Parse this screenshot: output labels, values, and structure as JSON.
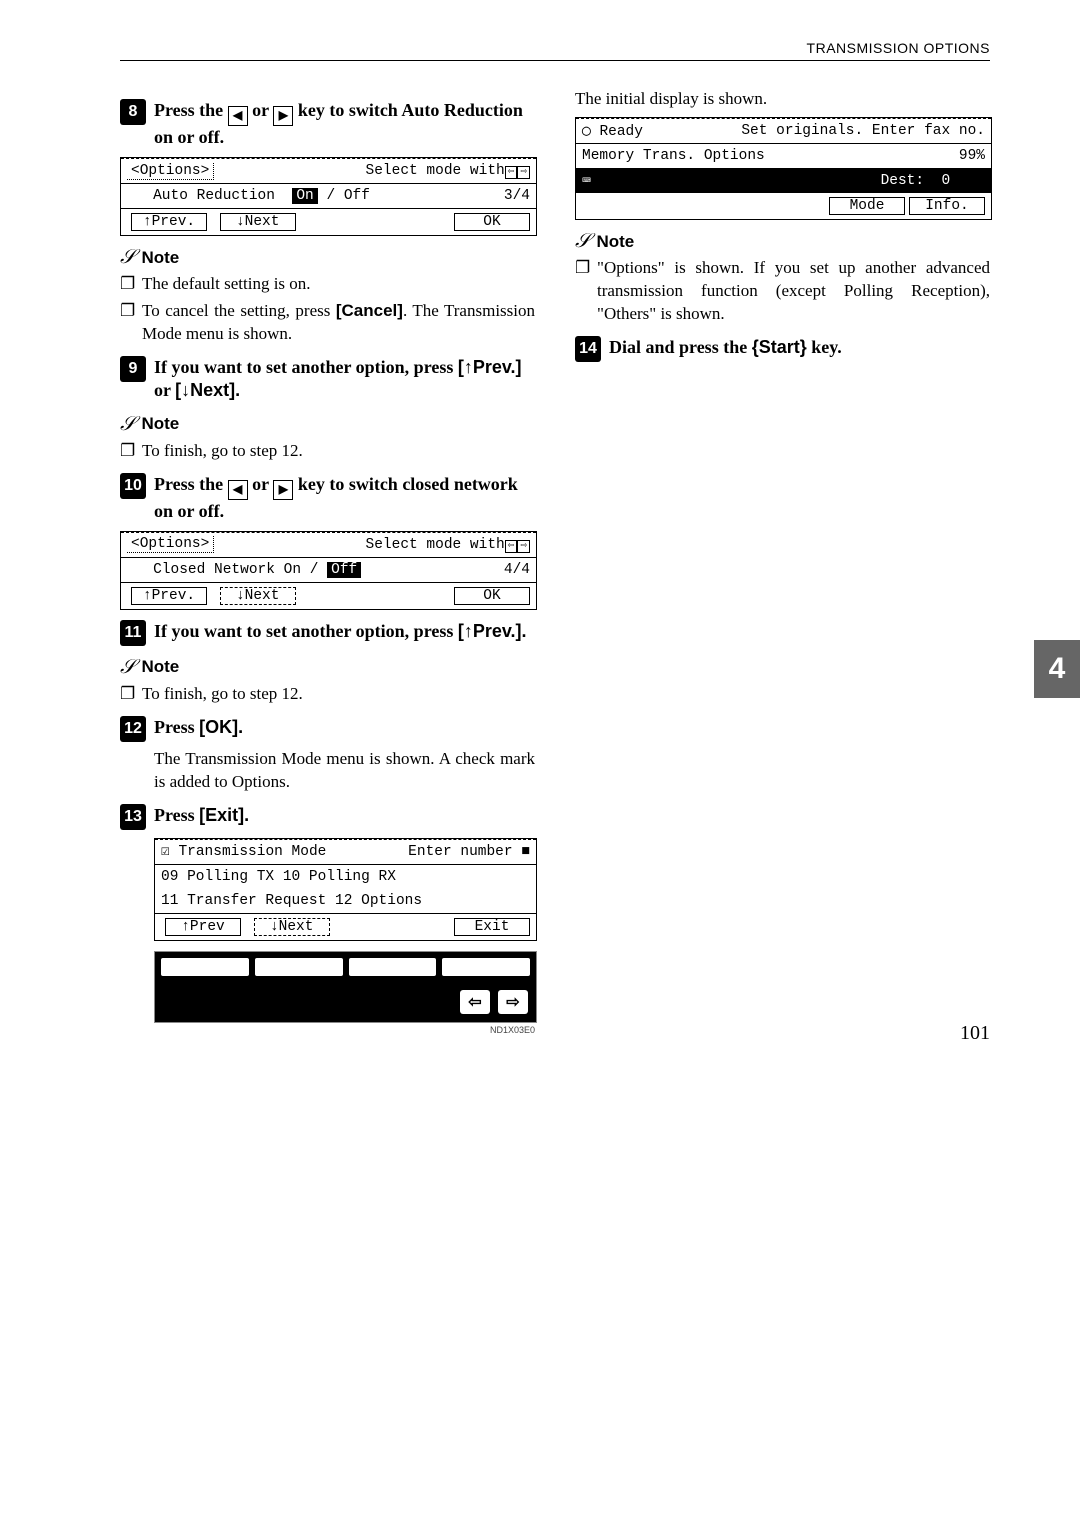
{
  "header": {
    "section_title": "TRANSMISSION OPTIONS"
  },
  "side_tab": "4",
  "page_number": "101",
  "left": {
    "step8": {
      "num": "8",
      "text_a": "Press the ",
      "text_b": " or ",
      "text_c": " key to switch Auto Reduction on or off."
    },
    "lcd1": {
      "title_left": "<Options>",
      "title_right": "Select mode with",
      "line2_left": "Auto Reduction",
      "line2_on": "On",
      "line2_off": " / Off",
      "line2_right": "3/4",
      "btn_prev": "↑Prev.",
      "btn_next": "↓Next",
      "btn_ok": "OK"
    },
    "note1": {
      "label": "Note",
      "items": [
        "The default setting is on.",
        "To cancel the setting, press [Cancel]. The Transmission Mode menu is shown."
      ]
    },
    "step9": {
      "num": "9",
      "text": "If you want to set another option, press [↑Prev.] or [↓Next]."
    },
    "note2": {
      "label": "Note",
      "items": [
        "To finish, go to step 12."
      ]
    },
    "step10": {
      "num": "10",
      "text_a": "Press the ",
      "text_b": " or ",
      "text_c": " key to switch closed network on or off."
    },
    "lcd2": {
      "title_left": "<Options>",
      "title_right": "Select mode with",
      "line2_left": "Closed Network  On / ",
      "line2_off": "Off",
      "line2_right": "4/4",
      "btn_prev": "↑Prev.",
      "btn_next": "↓Next",
      "btn_ok": "OK"
    },
    "step11": {
      "num": "11",
      "text": "If you want to set another option, press [↑Prev.]."
    },
    "note3": {
      "label": "Note",
      "items": [
        "To finish, go to step 12."
      ]
    },
    "step12": {
      "num": "12",
      "text": "Press [OK]."
    },
    "body12": "The Transmission Mode menu is shown. A check mark is added to Options.",
    "step13": {
      "num": "13",
      "text": "Press [Exit]."
    },
    "lcd3": {
      "title_left": "Transmission Mode",
      "title_right": "Enter number",
      "line2": "09 Polling TX      10 Polling RX",
      "line3": "11 Transfer Request 12 Options",
      "btn_prev": "↑Prev",
      "btn_next": "↓Next",
      "btn_exit": "Exit"
    },
    "arrows_caption": "ND1X03E0"
  },
  "right": {
    "intro": "The initial display is shown.",
    "lcd4": {
      "row1_left": "Ready",
      "row1_right": "Set originals. Enter fax no.",
      "row2_left": "Memory Trans. Options",
      "row2_right": "99%",
      "row3_dest": "Dest:",
      "row3_destval": "0",
      "row4_mode": "Mode",
      "row4_info": "Info."
    },
    "note4": {
      "label": "Note",
      "items": [
        "\"Options\" is shown. If you set up another advanced transmission function (except Polling Reception), \"Others\" is shown."
      ]
    },
    "step14": {
      "num": "14",
      "text": "Dial and press the {Start} key."
    }
  }
}
